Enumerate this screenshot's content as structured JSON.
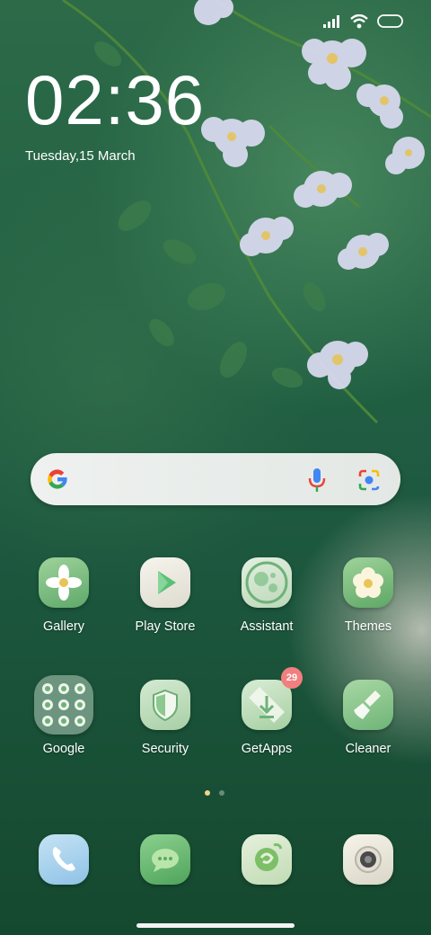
{
  "status_bar": {
    "signal_icon": "signal-bars-icon",
    "wifi_icon": "wifi-icon",
    "battery_icon": "battery-icon"
  },
  "lockscreen": {
    "time": "02:36",
    "date": "Tuesday,15 March"
  },
  "search": {
    "logo_icon": "google-g-icon",
    "mic_icon": "microphone-icon",
    "lens_icon": "google-lens-icon"
  },
  "apps_row1": [
    {
      "label": "Gallery",
      "icon": "gallery-flower-icon"
    },
    {
      "label": "Play Store",
      "icon": "play-store-icon"
    },
    {
      "label": "Assistant",
      "icon": "assistant-icon"
    },
    {
      "label": "Themes",
      "icon": "themes-flower-icon"
    }
  ],
  "apps_row2": [
    {
      "label": "Google",
      "icon": "google-folder-icon"
    },
    {
      "label": "Security",
      "icon": "security-shield-icon"
    },
    {
      "label": "GetApps",
      "icon": "getapps-download-icon",
      "badge": "29"
    },
    {
      "label": "Cleaner",
      "icon": "cleaner-brush-icon"
    }
  ],
  "dock": [
    {
      "icon": "phone-icon"
    },
    {
      "icon": "messages-icon"
    },
    {
      "icon": "browser-icon"
    },
    {
      "icon": "camera-icon"
    }
  ],
  "page_indicator": {
    "pages": 2,
    "active": 1
  },
  "colors": {
    "wallpaper": "#226144",
    "badge": "#f27f7f",
    "active_dot": "#f0d48a"
  }
}
